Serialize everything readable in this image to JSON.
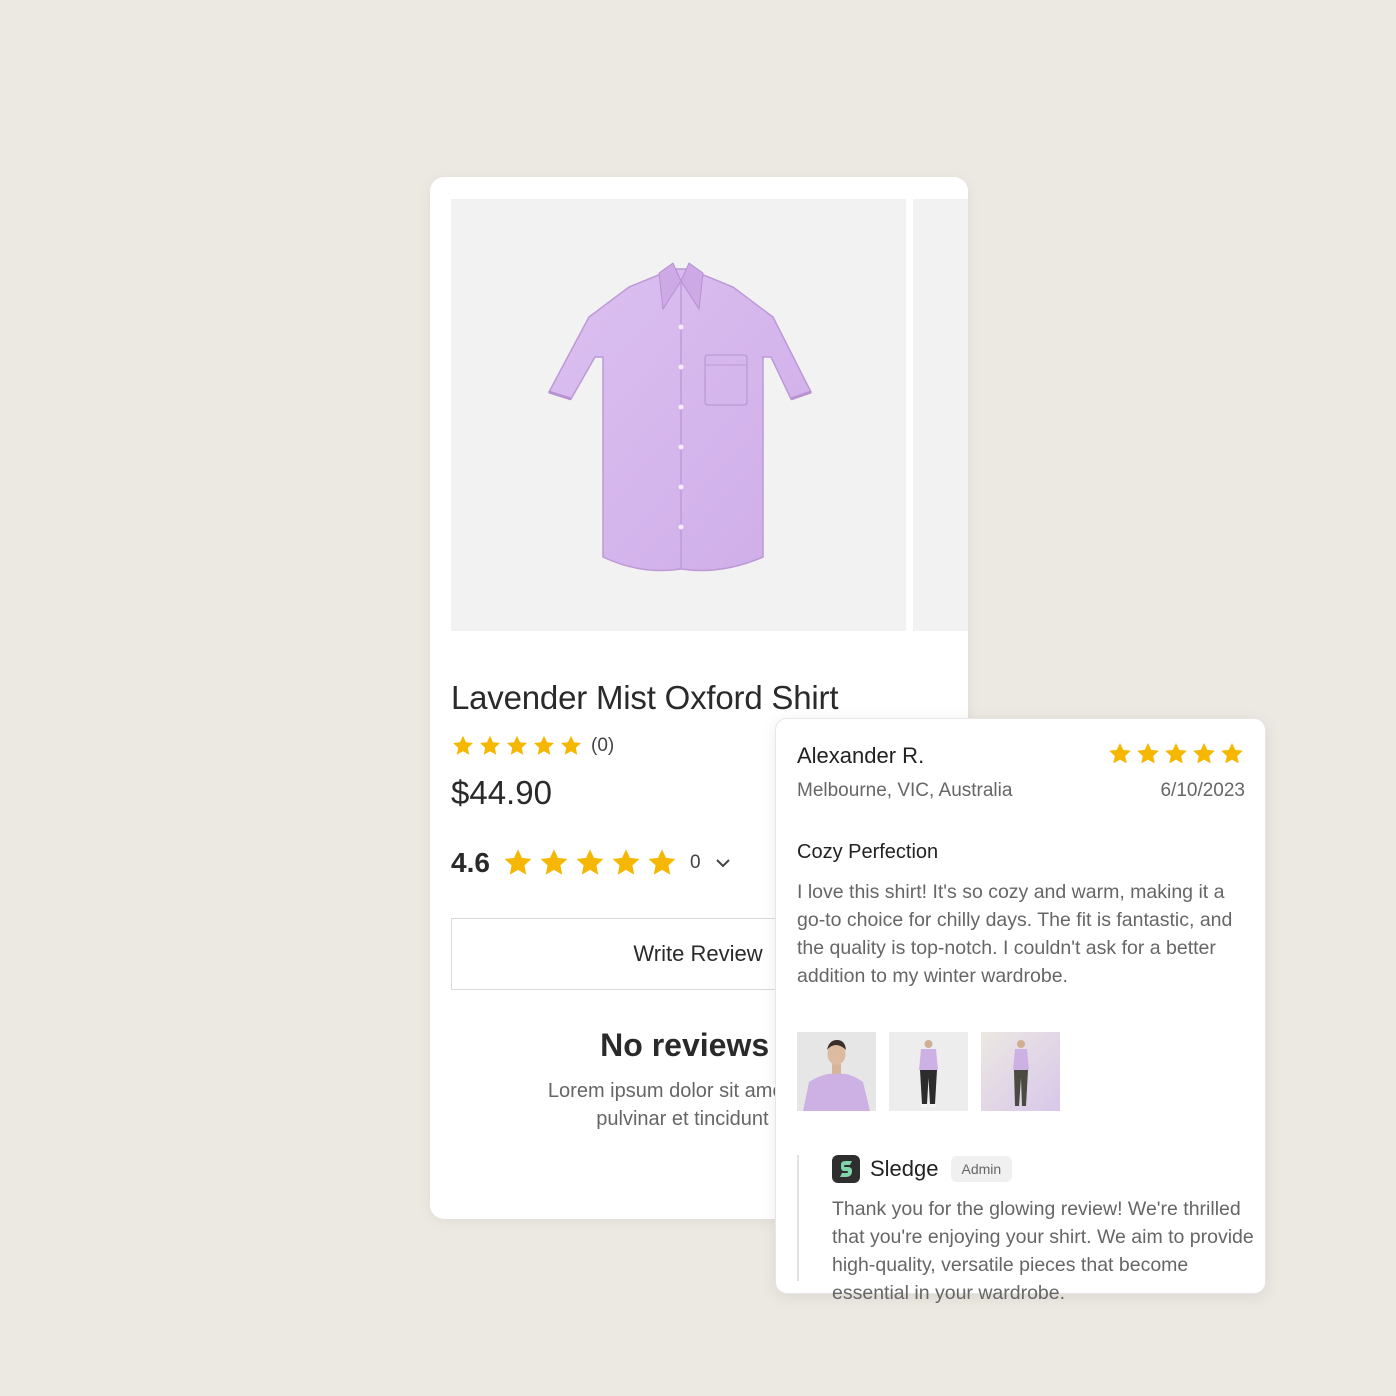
{
  "product": {
    "title": "Lavender Mist Oxford Shirt",
    "rating_count": "(0)",
    "price": "$44.90",
    "average_rating": "4.6",
    "review_count": "0",
    "write_review_label": "Write Review",
    "no_reviews_title": "No reviews y",
    "no_reviews_text_line1": "Lorem ipsum dolor sit amet conse",
    "no_reviews_text_line2": "pulvinar et tincidunt nis"
  },
  "review": {
    "author": "Alexander R.",
    "location": "Melbourne, VIC, Australia",
    "date": "6/10/2023",
    "stars": 5,
    "title": "Cozy Perfection",
    "body": "I love this shirt! It's so cozy and warm, making it a go-to choice for chilly days. The fit is fantastic, and the quality is top-notch. I couldn't ask for a better addition to my winter wardrobe.",
    "reply": {
      "brand": "Sledge",
      "badge": "Admin",
      "body": "Thank you for the glowing review! We're thrilled that you're enjoying your shirt. We aim to provide high-quality, versatile pieces that become essential in your wardrobe."
    }
  },
  "colors": {
    "star": "#F5B700",
    "shirt": "#D8B8EE",
    "background": "#ECE9E2"
  }
}
